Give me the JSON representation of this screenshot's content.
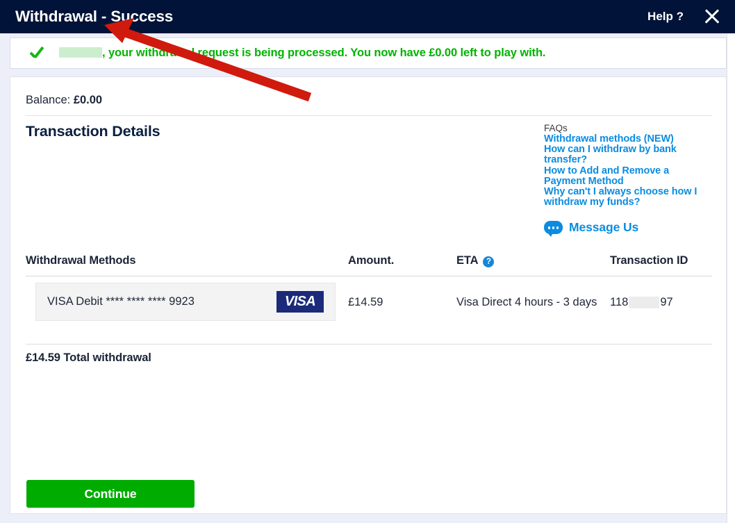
{
  "titlebar": {
    "title": "Withdrawal - Success",
    "help_label": "Help ?",
    "close_icon": "close-x-icon"
  },
  "banner": {
    "check_icon": "green-checkmark-icon",
    "text_before": "",
    "text_after": ", your withdrawal request is being processed. You now have £0.00 left to play with.",
    "redacted_name": "[redacted]"
  },
  "card": {
    "balance_label": "Balance:",
    "balance_value": "£0.00",
    "section_title": "Transaction Details"
  },
  "faq": {
    "title": "FAQs",
    "links": [
      "Withdrawal methods (NEW)",
      "How can I withdraw by bank transfer?",
      "How to Add and Remove a Payment Method",
      "Why can't I always choose how I withdraw my funds?"
    ],
    "message_us_label": "Message Us",
    "message_us_icon": "chat-bubble-icon"
  },
  "table": {
    "headers": {
      "methods": "Withdrawal Methods",
      "amount": "Amount.",
      "eta": "ETA",
      "eta_help_icon": "question-mark-icon",
      "eta_help_glyph": "?",
      "transaction_id": "Transaction ID"
    },
    "rows": [
      {
        "method": "VISA Debit **** **** **** 9923",
        "card_brand": "VISA",
        "amount": "£14.59",
        "eta": "Visa Direct 4 hours - 3 days",
        "txn_prefix": "118",
        "txn_suffix": "97"
      }
    ],
    "total_line": "£14.59 Total withdrawal"
  },
  "actions": {
    "continue_label": "Continue"
  },
  "colors": {
    "titlebar_bg": "#011338",
    "success_green": "#00b300",
    "link_blue": "#0b8ce0",
    "button_green": "#01ac01",
    "visa_navy": "#1b2a79",
    "annotation_red": "#d01a0e",
    "page_bg": "#eceef8"
  }
}
